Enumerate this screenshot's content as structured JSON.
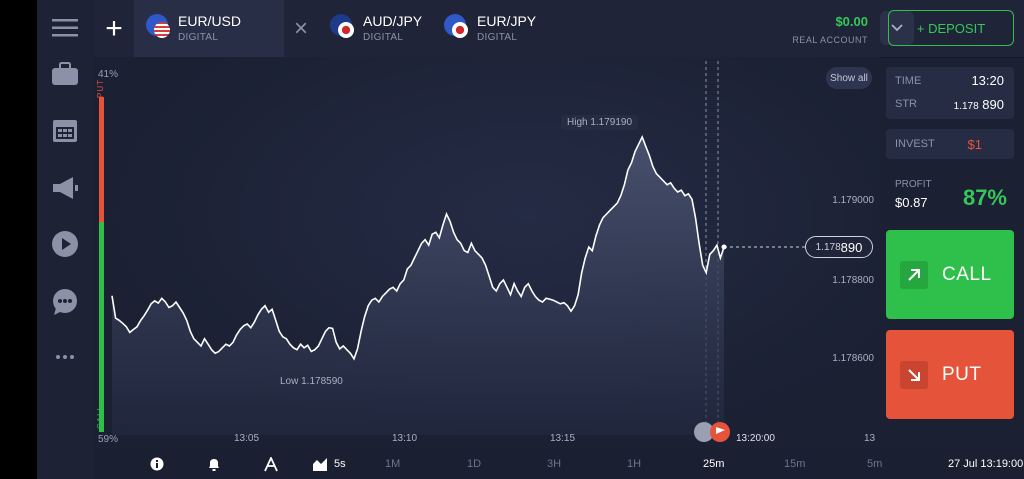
{
  "topbar": {
    "tabs": [
      {
        "name": "EUR/USD",
        "type": "DIGITAL"
      },
      {
        "name": "AUD/JPY",
        "type": "DIGITAL"
      },
      {
        "name": "EUR/JPY",
        "type": "DIGITAL"
      }
    ],
    "balance": "$0.00",
    "account": "REAL ACCOUNT",
    "deposit_label": "+ DEPOSIT"
  },
  "sidebar": {
    "icons": [
      "menu-icon",
      "portfolio-icon",
      "calendar-icon",
      "megaphone-icon",
      "play-icon",
      "chat-icon",
      "more-icon"
    ]
  },
  "chart": {
    "put_pct": "41%",
    "call_pct": "59%",
    "put_label": "PUT",
    "call_label": "CALL",
    "high_label": "High 1.179190",
    "low_label": "Low 1.178590",
    "price_ticks": [
      "1.179000",
      "1.178800",
      "1.178600"
    ],
    "time_ticks": [
      "13:05",
      "13:10",
      "13:15"
    ],
    "expiry_time": "13:20:00",
    "expiry_tick": "13",
    "current_price_main": "1.178",
    "current_price_tail": "890",
    "show_all": "Show all",
    "price_series": [
      1.178757,
      1.178696,
      1.17869,
      1.178682,
      1.178673,
      1.178657,
      1.178665,
      1.178672,
      1.178689,
      1.178702,
      1.178718,
      1.178735,
      1.178743,
      1.178737,
      1.17875,
      1.17874,
      1.178725,
      1.17873,
      1.17874,
      1.178725,
      1.17871,
      1.17869,
      1.17866,
      1.17864,
      1.17863,
      1.17862,
      1.17864,
      1.178625,
      1.17861,
      1.1786,
      1.178605,
      1.178615,
      1.178625,
      1.17862,
      1.17863,
      1.17865,
      1.178665,
      1.178675,
      1.17868,
      1.17867,
      1.178685,
      1.178705,
      1.17872,
      1.17873,
      1.178712,
      1.17872,
      1.17869,
      1.17866,
      1.178645,
      1.17864,
      1.178625,
      1.178615,
      1.17861,
      1.178625,
      1.178615,
      1.178622,
      1.178605,
      1.17861,
      1.17862,
      1.17864,
      1.17866,
      1.17867,
      1.178668,
      1.17863,
      1.178612,
      1.17862,
      1.17861,
      1.1786,
      1.178585,
      1.178612,
      1.17866,
      1.1787,
      1.17873,
      1.178745,
      1.17875,
      1.17874,
      1.178755,
      1.178765,
      1.178775,
      1.17878,
      1.17877,
      1.17879,
      1.1788,
      1.17883,
      1.17884,
      1.17886,
      1.17888,
      1.1789,
      1.17891,
      1.178895,
      1.178925,
      1.17893,
      1.178915,
      1.17895,
      1.17898,
      1.17896,
      1.17893,
      1.17891,
      1.1789,
      1.17888,
      1.178875,
      1.1789,
      1.17888,
      1.17887,
      1.17886,
      1.17884,
      1.17881,
      1.17878,
      1.17877,
      1.17879,
      1.1788,
      1.17878,
      1.17876,
      1.17879,
      1.17877,
      1.178755,
      1.17878,
      1.17879,
      1.17877,
      1.178755,
      1.178745,
      1.17874,
      1.17875,
      1.178748,
      1.178745,
      1.17874,
      1.178735,
      1.178738,
      1.17873,
      1.178715,
      1.17873,
      1.17876,
      1.17882,
      1.17886,
      1.17889,
      1.17888,
      1.17892,
      1.17895,
      1.17897,
      1.17898,
      1.17899,
      1.179,
      1.17901,
      1.17903,
      1.17906,
      1.1791,
      1.17912,
      1.17915,
      1.17917,
      1.17919,
      1.179165,
      1.17914,
      1.17911,
      1.17909,
      1.17908,
      1.17907,
      1.17906,
      1.179065,
      1.17905,
      1.17904,
      1.179045,
      1.17903,
      1.179035,
      1.17902,
      1.17897,
      1.1789,
      1.17884,
      1.17882,
      1.17887,
      1.17888,
      1.178895,
      1.17886,
      1.17889
    ]
  },
  "panel": {
    "time_label": "TIME",
    "time_value": "13:20",
    "str_label": "STR",
    "str_main": "1.178",
    "str_tail": "890",
    "invest_label": "INVEST",
    "invest_value": "$1",
    "profit_label": "PROFIT",
    "profit_value": "$0.87",
    "profit_pct": "87%",
    "call_label": "CALL",
    "put_label": "PUT"
  },
  "bottombar": {
    "timeframes": [
      "5s",
      "1M",
      "1D",
      "3H",
      "1H",
      "25m",
      "15m",
      "5m"
    ],
    "active_timeframe": "25m",
    "datetime": "27 Jul 13:19:00"
  },
  "colors": {
    "call": "#2fbf4b",
    "put": "#e5533b",
    "background": "#1b2033"
  }
}
